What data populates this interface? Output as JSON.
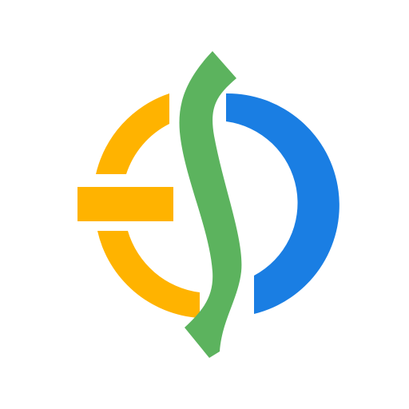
{
  "colors": {
    "background": "#ffffff",
    "yellow": "#ffb300",
    "green": "#5cb35e",
    "blue": "#1a7ee3"
  },
  "logo": {
    "icon": "abstract-circle-logo-icon"
  }
}
